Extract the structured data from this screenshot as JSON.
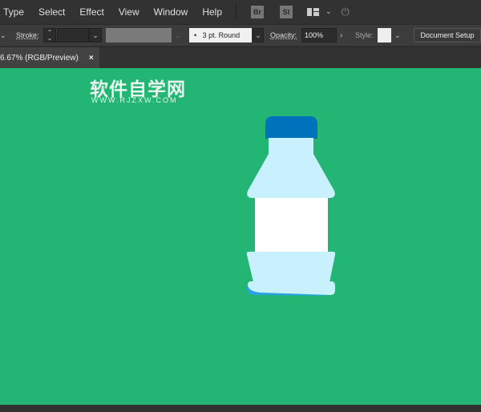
{
  "menu": [
    "Type",
    "Select",
    "Effect",
    "View",
    "Window",
    "Help"
  ],
  "app_buttons": {
    "bridge": "Br",
    "stock": "St"
  },
  "control": {
    "stroke_label": "Stroke:",
    "brush": "3 pt. Round",
    "opacity_label": "Opacity:",
    "opacity": "100%",
    "style_label": "Style:",
    "document_setup": "Document Setup"
  },
  "tab": {
    "title": "6.67% (RGB/Preview)",
    "close": "×"
  },
  "watermark": {
    "cn": "软件自学网",
    "url": "WWW.RJZXW.COM"
  },
  "colors": {
    "canvas": "#23b573",
    "cap": "#0072bc",
    "bottle": "#c8f0fd",
    "label": "#ffffff",
    "base_shadow": "#29a3e0"
  }
}
